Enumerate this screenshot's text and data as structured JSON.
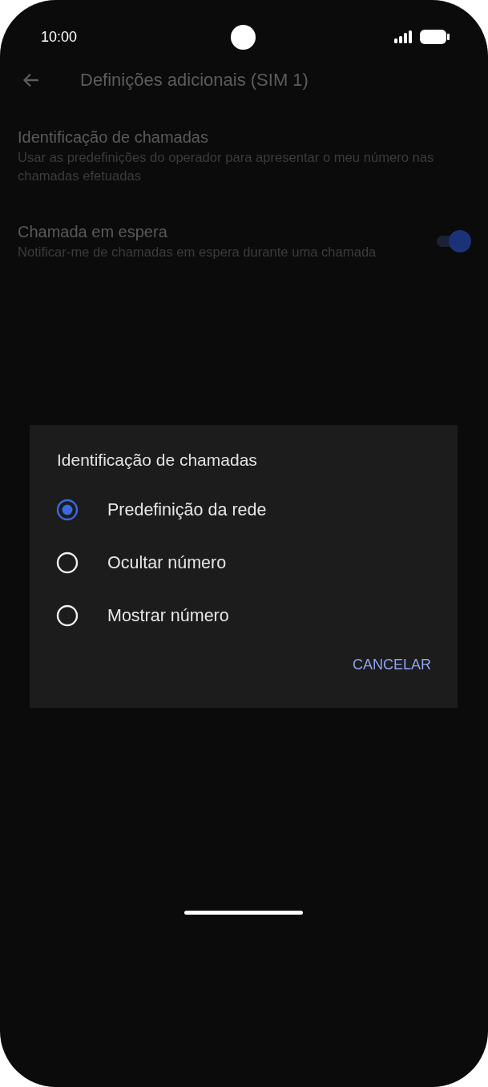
{
  "status_bar": {
    "time": "10:00"
  },
  "app_bar": {
    "title": "Definições adicionais (SIM 1)"
  },
  "settings": [
    {
      "kind": "plain",
      "title": "Identificação de chamadas",
      "summary": "Usar as predefinições do operador para apresentar o meu número nas chamadas efetuadas"
    },
    {
      "kind": "switch",
      "title": "Chamada em espera",
      "summary": "Notificar-me de chamadas em espera durante uma chamada",
      "on": true
    }
  ],
  "dialog": {
    "title": "Identificação de chamadas",
    "options": [
      {
        "label": "Predefinição da rede",
        "selected": true
      },
      {
        "label": "Ocultar número",
        "selected": false
      },
      {
        "label": "Mostrar número",
        "selected": false
      }
    ],
    "buttons": [
      "CANCELAR"
    ]
  }
}
